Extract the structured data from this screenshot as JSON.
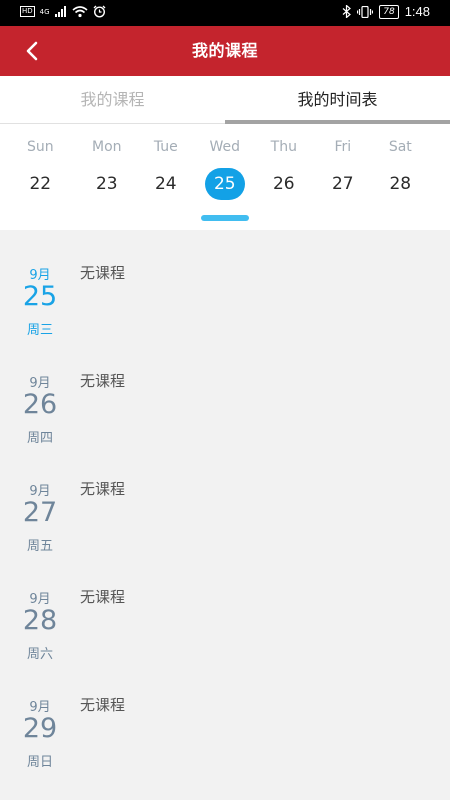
{
  "status_bar": {
    "network": "4G",
    "battery": "78",
    "time": "1:48"
  },
  "header": {
    "title": "我的课程"
  },
  "tabs": [
    {
      "label": "我的课程",
      "active": false
    },
    {
      "label": "我的时间表",
      "active": true
    }
  ],
  "week": {
    "days": [
      {
        "dow": "Sun",
        "date": "22"
      },
      {
        "dow": "Mon",
        "date": "23"
      },
      {
        "dow": "Tue",
        "date": "24"
      },
      {
        "dow": "Wed",
        "date": "25",
        "selected": true
      },
      {
        "dow": "Thu",
        "date": "26"
      },
      {
        "dow": "Fri",
        "date": "27"
      },
      {
        "dow": "Sat",
        "date": "28"
      }
    ]
  },
  "schedule": [
    {
      "month": "9月",
      "day": "25",
      "weekday": "周三",
      "status": "无课程",
      "today": true
    },
    {
      "month": "9月",
      "day": "26",
      "weekday": "周四",
      "status": "无课程"
    },
    {
      "month": "9月",
      "day": "27",
      "weekday": "周五",
      "status": "无课程"
    },
    {
      "month": "9月",
      "day": "28",
      "weekday": "周六",
      "status": "无课程"
    },
    {
      "month": "9月",
      "day": "29",
      "weekday": "周日",
      "status": "无课程"
    }
  ],
  "colors": {
    "app_bar": "#c4242d",
    "accent": "#13a1e6",
    "date_text": "#6f859a"
  }
}
